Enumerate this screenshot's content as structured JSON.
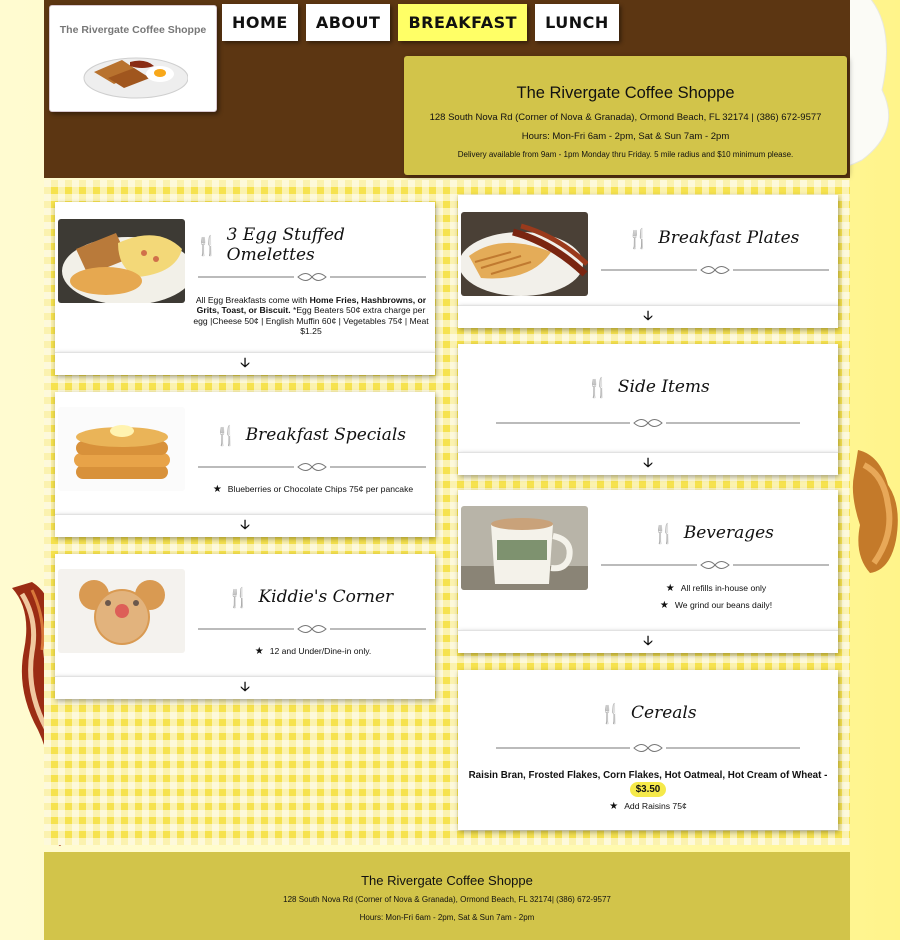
{
  "brand": {
    "logo_text": "The Rivergate Coffee Shoppe",
    "colors": {
      "header_bg": "#5c3612",
      "info_bg": "#d2c44a",
      "nav_active": "#ffff66",
      "gingham": "#f6e24e"
    }
  },
  "nav": {
    "items": [
      {
        "label": "HOME",
        "active": false
      },
      {
        "label": "ABOUT",
        "active": false
      },
      {
        "label": "BREAKFAST",
        "active": true
      },
      {
        "label": "LUNCH",
        "active": false
      }
    ]
  },
  "info": {
    "name": "The Rivergate Coffee Shoppe",
    "address": "128 South Nova Rd (Corner of Nova & Granada), Ormond Beach, FL 32174 | (386) 672-9577",
    "hours": "Hours: Mon-Fri 6am - 2pm, Sat & Sun 7am - 2pm",
    "delivery": "Delivery available from 9am - 1pm Monday thru Friday. 5 mile radius and $10 minimum please."
  },
  "menu": {
    "omelettes": {
      "title": "3 Egg Stuffed Omelettes",
      "desc_a": "All Egg Breakfasts come with ",
      "desc_b": "Home Fries, Hashbrowns, or Grits, Toast, or Biscuit.",
      "desc_c": " *Egg Beaters 50¢ extra charge per egg |Cheese 50¢ | English Muffin 60¢ | Vegetables 75¢ | Meat $1.25",
      "expand": "🡣"
    },
    "specials": {
      "title": "Breakfast Specials",
      "bullet": "Blueberries or Chocolate Chips 75¢ per pancake",
      "expand": "🡣"
    },
    "kiddie": {
      "title": "Kiddie's Corner",
      "bullet": "12 and Under/Dine-in only.",
      "expand": "🡣"
    },
    "plates": {
      "title": "Breakfast Plates",
      "expand": "🡣"
    },
    "sides": {
      "title": "Side Items",
      "expand": "🡣"
    },
    "beverages": {
      "title": "Beverages",
      "bullet_1": "All refills in-house only",
      "bullet_2": "We grind our beans daily!",
      "expand": "🡣"
    },
    "cereals": {
      "title": "Cereals",
      "desc": "Raisin Bran, Frosted Flakes, Corn Flakes, Hot Oatmeal, Hot Cream of Wheat - ",
      "price": "$3.50",
      "bullet": "Add Raisins 75¢"
    }
  },
  "footer": {
    "name": "The Rivergate Coffee Shoppe",
    "address": "128 South Nova Rd (Corner of Nova & Granada), Ormond Beach, FL 32174| (386) 672-9577",
    "hours": "Hours: Mon-Fri 6am - 2pm, Sat & Sun 7am - 2pm"
  },
  "icons": {
    "utensils": "fork-knife-icon",
    "star": "star-icon",
    "expand": "down-arrow-icon"
  }
}
